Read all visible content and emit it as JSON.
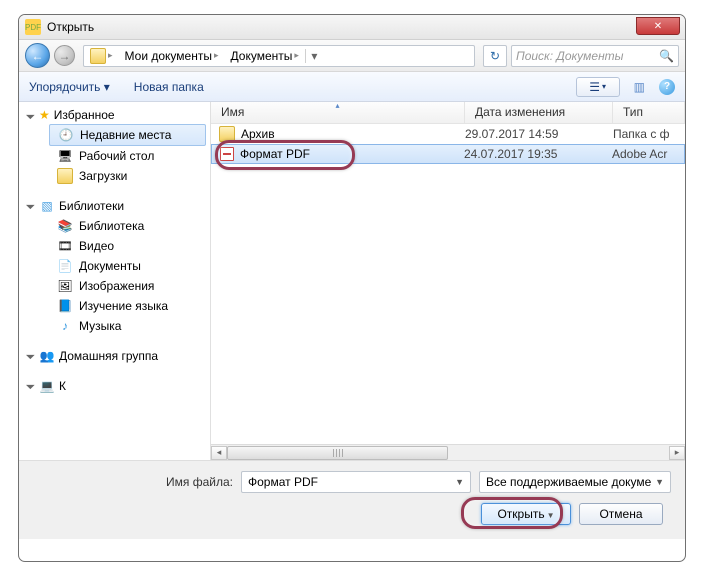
{
  "title": "Открыть",
  "breadcrumb": {
    "seg1": "Мои документы",
    "seg2": "Документы"
  },
  "search": {
    "placeholder": "Поиск: Документы"
  },
  "toolbar": {
    "organize": "Упорядочить",
    "newfolder": "Новая папка"
  },
  "columns": {
    "name": "Имя",
    "date": "Дата изменения",
    "type": "Тип"
  },
  "sidebar": {
    "favorites": {
      "label": "Избранное",
      "items": [
        "Недавние места",
        "Рабочий стол",
        "Загрузки"
      ]
    },
    "libraries": {
      "label": "Библиотеки",
      "items": [
        "Библиотека",
        "Видео",
        "Документы",
        "Изображения",
        "Изучение языка",
        "Музыка"
      ]
    },
    "homegroup": {
      "label": "Домашняя группа"
    }
  },
  "files": [
    {
      "name": "Архив",
      "date": "29.07.2017 14:59",
      "type": "Папка с ф",
      "kind": "folder"
    },
    {
      "name": "Формат PDF",
      "date": "24.07.2017 19:35",
      "type": "Adobe Acr",
      "kind": "pdf"
    }
  ],
  "bottom": {
    "filename_label": "Имя файла:",
    "filename_value": "Формат PDF",
    "filter": "Все поддерживаемые докуме",
    "open": "Открыть",
    "cancel": "Отмена"
  }
}
